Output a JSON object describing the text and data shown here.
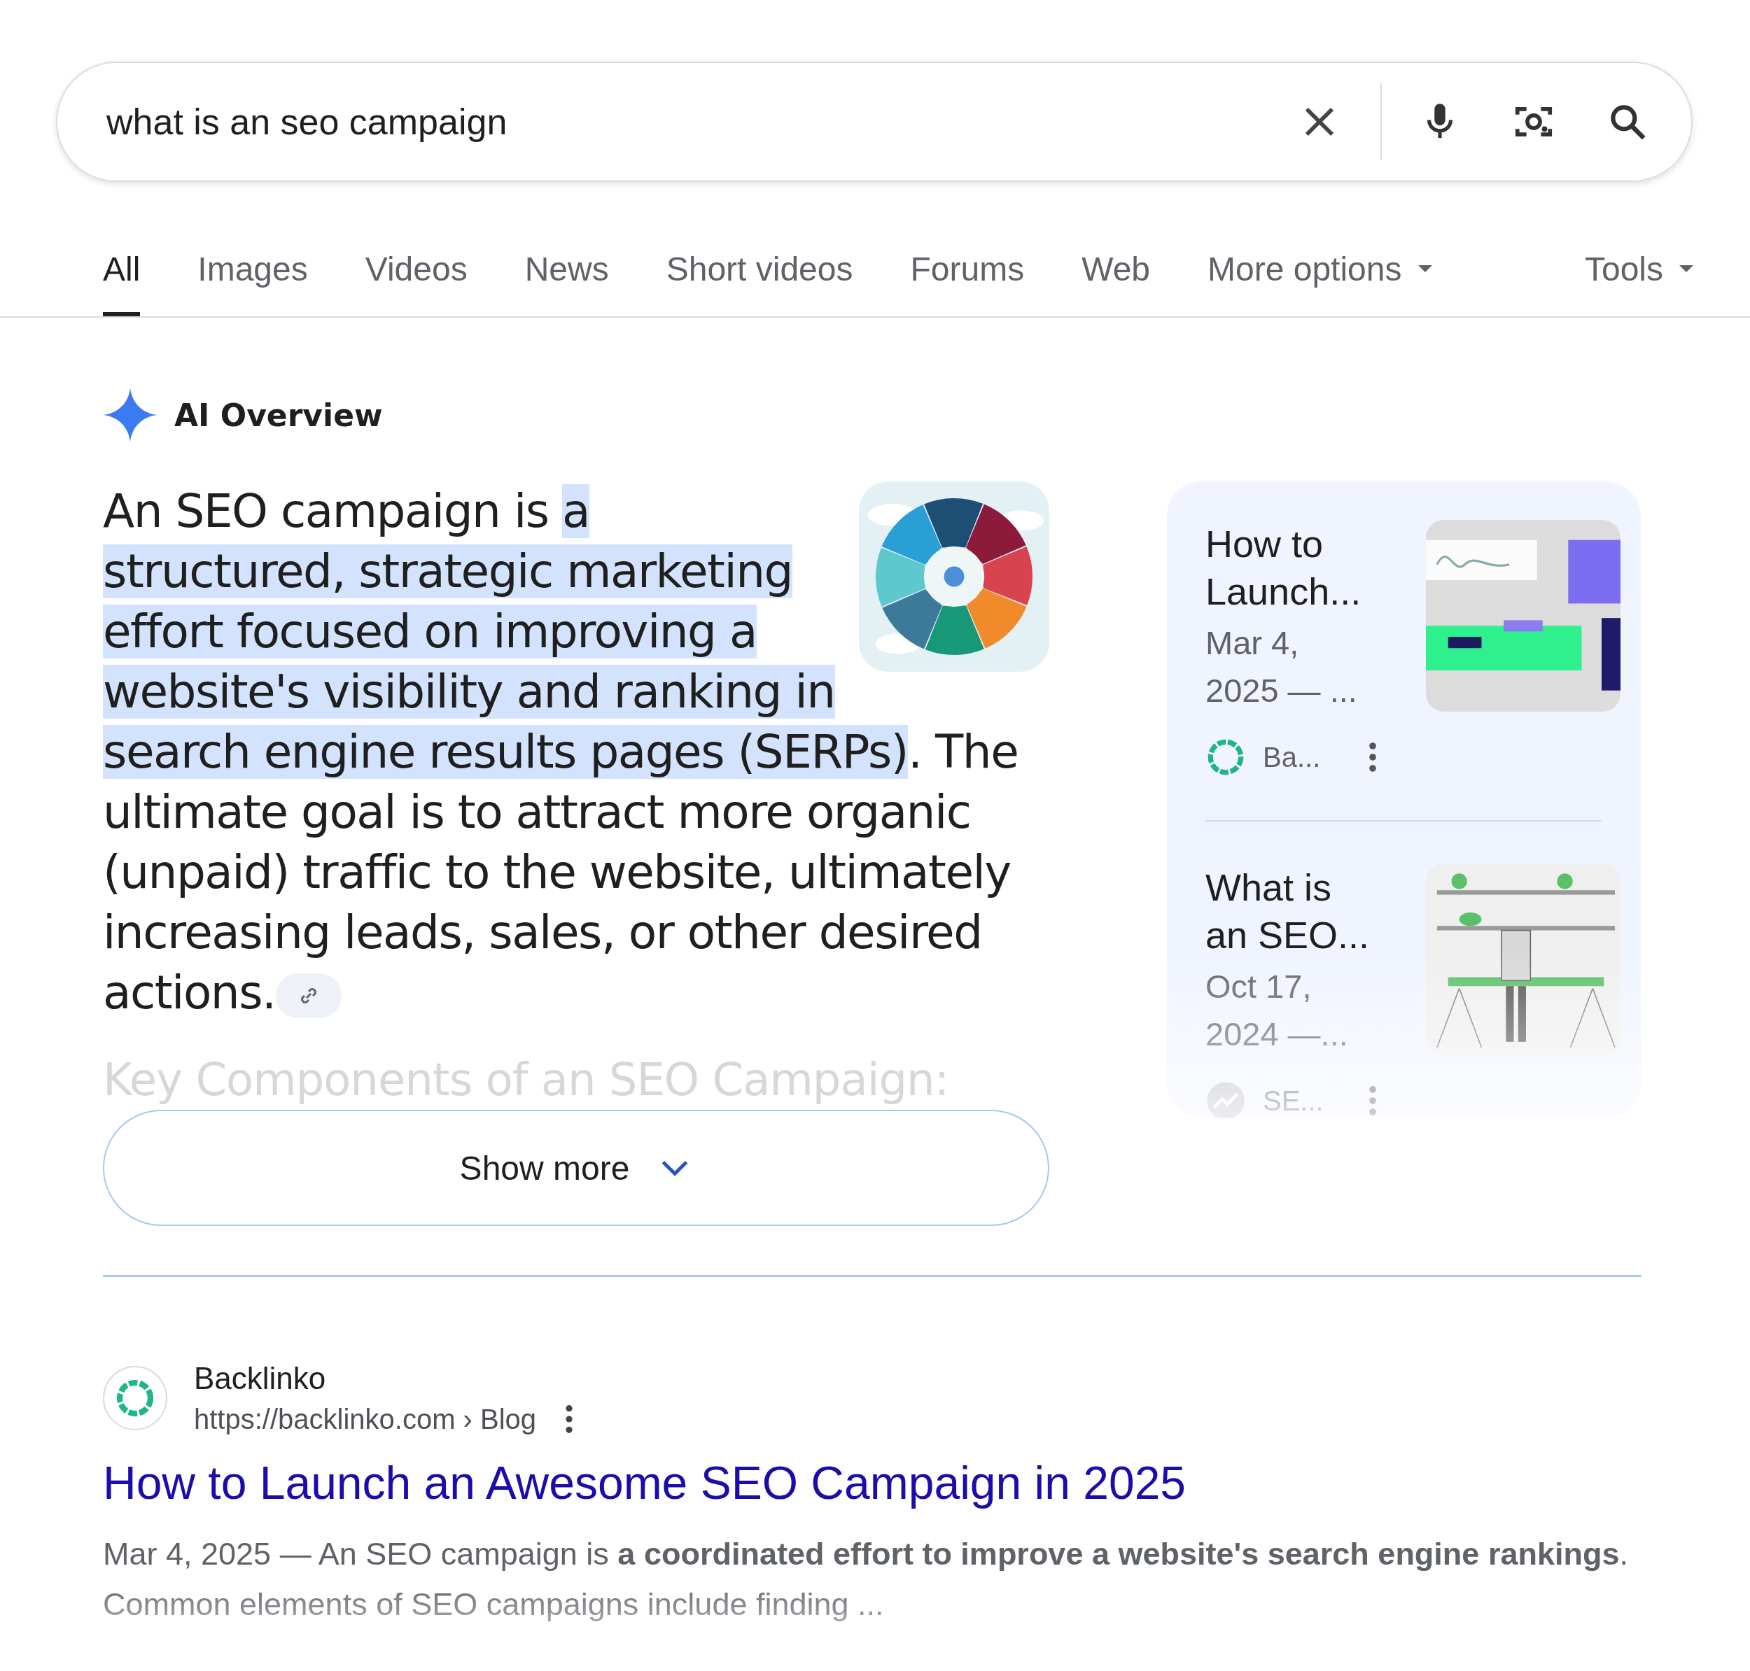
{
  "search": {
    "value": "what is an seo campaign"
  },
  "tabs": [
    {
      "label": "All",
      "selected": true,
      "dropdown": false
    },
    {
      "label": "Images",
      "selected": false,
      "dropdown": false
    },
    {
      "label": "Videos",
      "selected": false,
      "dropdown": false
    },
    {
      "label": "News",
      "selected": false,
      "dropdown": false
    },
    {
      "label": "Short videos",
      "selected": false,
      "dropdown": false
    },
    {
      "label": "Forums",
      "selected": false,
      "dropdown": false
    },
    {
      "label": "Web",
      "selected": false,
      "dropdown": false
    },
    {
      "label": "More options",
      "selected": false,
      "dropdown": true
    }
  ],
  "tools": {
    "label": "Tools"
  },
  "ai_overview": {
    "title": "AI Overview",
    "parts": [
      {
        "text": "An SEO campaign is ",
        "highlighted": false
      },
      {
        "text": "a structured, strategic marketing effort focused on improving a website's visibility and ranking in search engine results pages (SERPs)",
        "highlighted": true
      },
      {
        "text": ". The ultimate goal is to attract more organic (unpaid) traffic to the website, ultimately increasing leads, sales, or other desired actions.",
        "highlighted": false
      }
    ],
    "faded_heading": "Key Components of an SEO Campaign:",
    "show_more": "Show more",
    "sources": [
      {
        "title": "How to Launch...",
        "date": "Mar 4, 2025 — ...",
        "site": "Ba...",
        "kind": "ring"
      },
      {
        "title": "What is an SEO...",
        "date": "Oct 17, 2024 —...",
        "site": "SE...",
        "kind": "trend"
      }
    ]
  },
  "result": {
    "site": "Backlinko",
    "url": "https://backlinko.com › Blog",
    "title": "How to Launch an Awesome SEO Campaign in 2025",
    "snippet": "Mar 4, 2025 — An SEO campaign is **a coordinated effort to improve a website's search engine rankings**. Common elements of SEO campaigns include finding ..."
  }
}
